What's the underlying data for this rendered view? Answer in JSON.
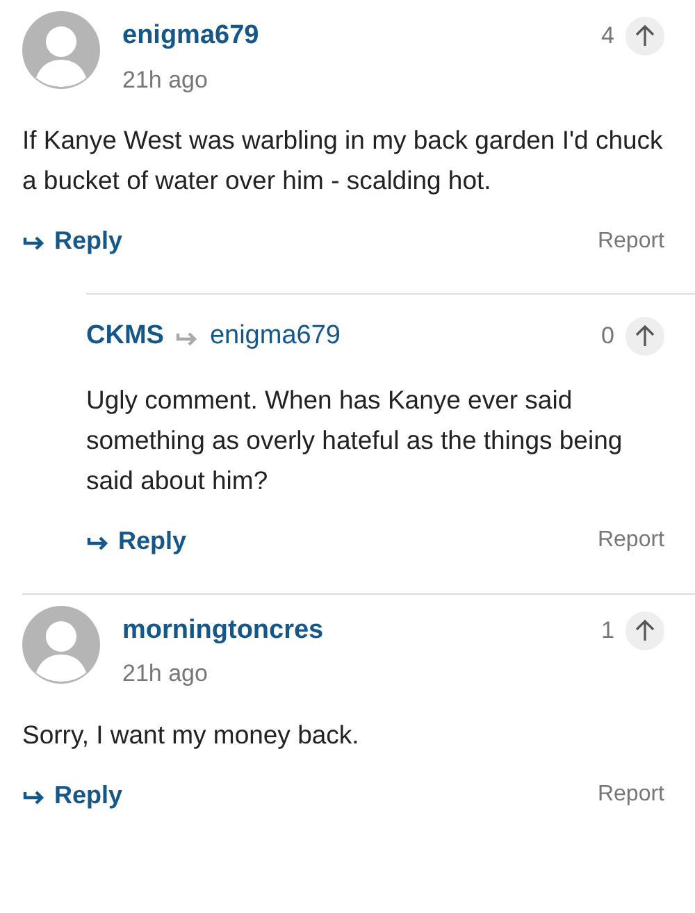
{
  "comments": [
    {
      "kind": "top",
      "author": "enigma679",
      "time": "21h ago",
      "votes": "4",
      "body": "If Kanye West was warbling in my back garden I'd chuck a bucket of water over him - scalding hot.",
      "reply": "Reply",
      "report": "Report"
    },
    {
      "kind": "reply",
      "author": "CKMS",
      "reply_to": "enigma679",
      "votes": "0",
      "body": "Ugly comment. When has Kanye ever said something as overly hateful as the things being said about him?",
      "reply": "Reply",
      "report": "Report"
    },
    {
      "kind": "top",
      "author": "morningtoncres",
      "time": "21h ago",
      "votes": "1",
      "body": "Sorry, I want my money back.",
      "reply": "Reply",
      "report": "Report"
    }
  ]
}
